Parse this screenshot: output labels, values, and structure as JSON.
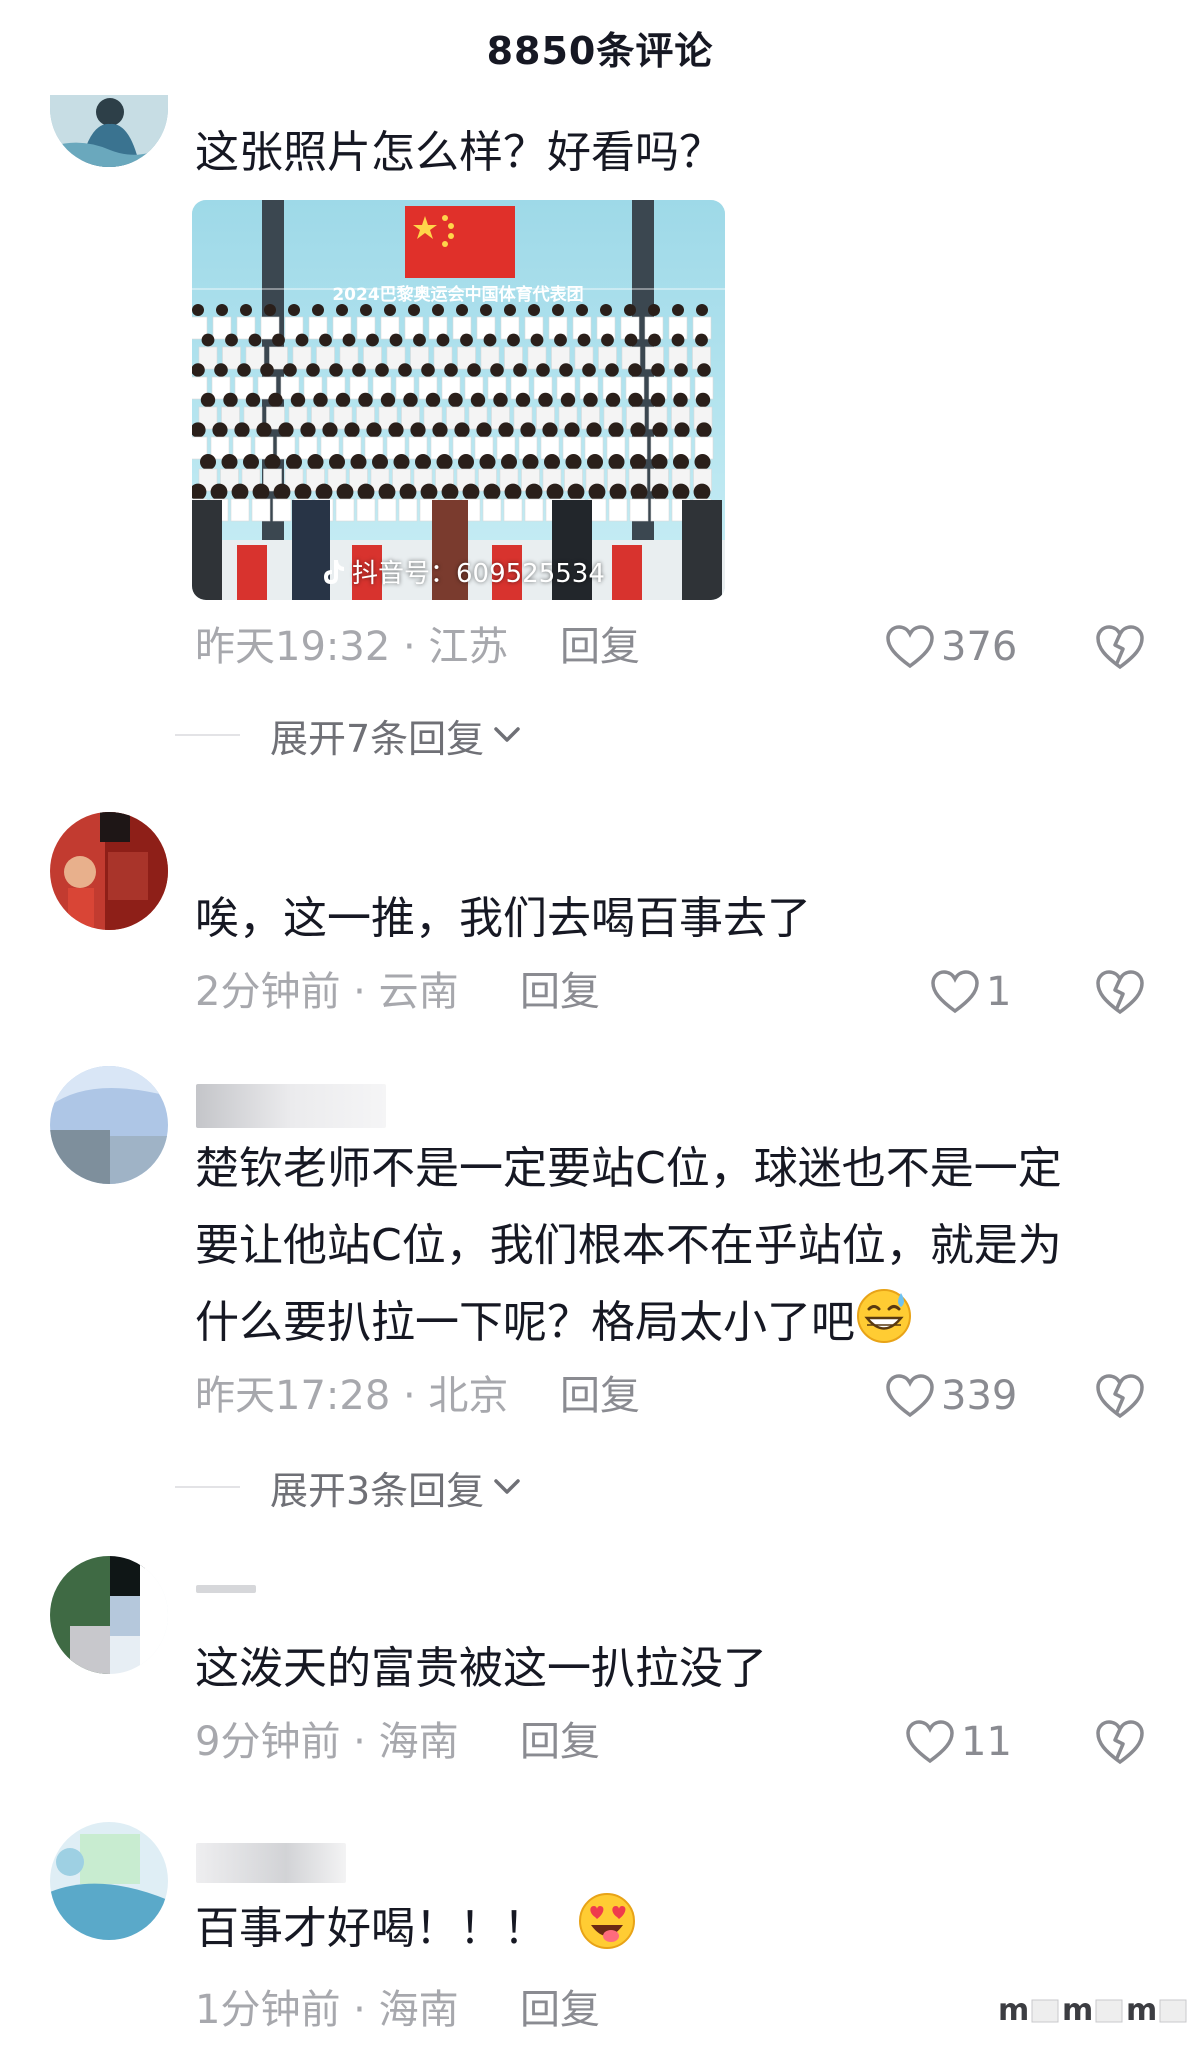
{
  "header": {
    "title": "8850条评论"
  },
  "comments": [
    {
      "text": "这张照片怎么样？好看吗？",
      "image": {
        "banner": "2024巴黎奥运会中国体育代表团",
        "watermark": "抖音号：609525534"
      },
      "time_location": "昨天19:32 · 江苏",
      "reply": "回复",
      "likes": "376",
      "expand": "展开7条回复"
    },
    {
      "text": "唉，这一推，我们去喝百事去了",
      "time_location": "2分钟前 · 云南",
      "reply": "回复",
      "likes": "1"
    },
    {
      "lines": [
        "楚钦老师不是一定要站C位，球迷也不是一定",
        "要让他站C位，我们根本不在乎站位，就是为",
        "什么要扒拉一下呢？格局太小了吧"
      ],
      "time_location": "昨天17:28 · 北京",
      "reply": "回复",
      "likes": "339",
      "expand": "展开3条回复"
    },
    {
      "text": "这泼天的富贵被这一扒拉没了",
      "time_location": "9分钟前 · 海南",
      "reply": "回复",
      "likes": "11"
    },
    {
      "text": "百事才好喝！！！",
      "time_location": "1分钟前 · 海南",
      "reply": "回复"
    }
  ],
  "icons": {
    "like": "heart-outline-icon",
    "dislike": "broken-heart-icon",
    "expand": "chevron-down-icon"
  },
  "colors": {
    "text_primary": "#161823",
    "text_meta": "#a7a8ad",
    "icon_gray": "#8a8b91"
  }
}
